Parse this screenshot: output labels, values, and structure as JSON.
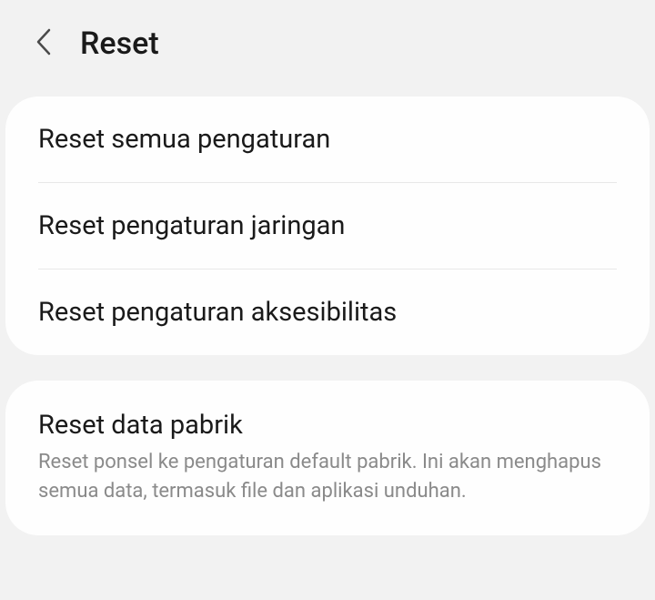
{
  "header": {
    "title": "Reset"
  },
  "group1": {
    "items": [
      {
        "title": "Reset semua pengaturan"
      },
      {
        "title": "Reset pengaturan jaringan"
      },
      {
        "title": "Reset pengaturan aksesibilitas"
      }
    ]
  },
  "group2": {
    "items": [
      {
        "title": "Reset data pabrik",
        "description": "Reset ponsel ke pengaturan default pabrik. Ini akan menghapus semua data, termasuk file dan aplikasi unduhan."
      }
    ]
  }
}
